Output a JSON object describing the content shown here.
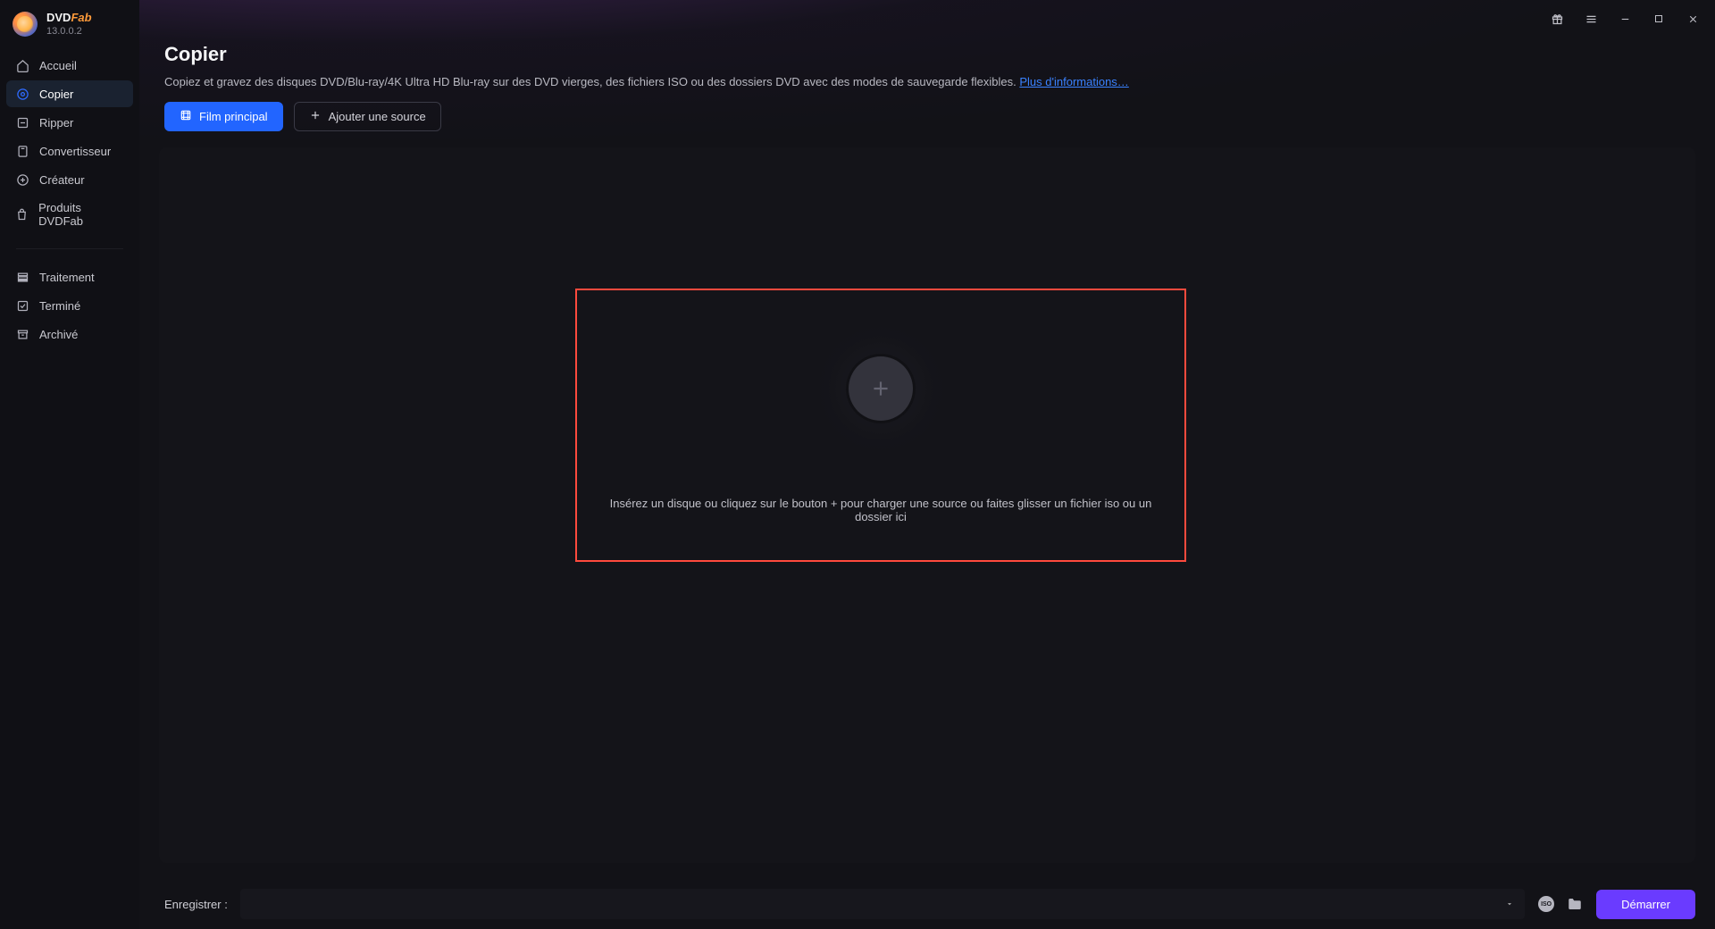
{
  "app": {
    "name_plain": "DVD",
    "name_accent": "Fab",
    "version": "13.0.0.2"
  },
  "sidebar": {
    "items": [
      {
        "label": "Accueil"
      },
      {
        "label": "Copier"
      },
      {
        "label": "Ripper"
      },
      {
        "label": "Convertisseur"
      },
      {
        "label": "Créateur"
      },
      {
        "label": "Produits DVDFab"
      }
    ],
    "tasks": [
      {
        "label": "Traitement"
      },
      {
        "label": "Terminé"
      },
      {
        "label": "Archivé"
      }
    ]
  },
  "header": {
    "title": "Copier",
    "description": "Copiez et gravez des disques DVD/Blu-ray/4K Ultra HD Blu-ray sur des DVD vierges, des fichiers ISO ou des dossiers DVD avec des modes de sauvegarde flexibles. ",
    "more_link": "Plus d'informations…"
  },
  "actions": {
    "main_movie": "Film principal",
    "add_source": "Ajouter une source"
  },
  "dropzone": {
    "text": "Insérez un disque ou cliquez sur le bouton +  pour charger une source ou faites glisser un fichier iso ou un dossier ici"
  },
  "footer": {
    "save_label": "Enregistrer :",
    "iso_label": "ISO",
    "start": "Démarrer"
  }
}
